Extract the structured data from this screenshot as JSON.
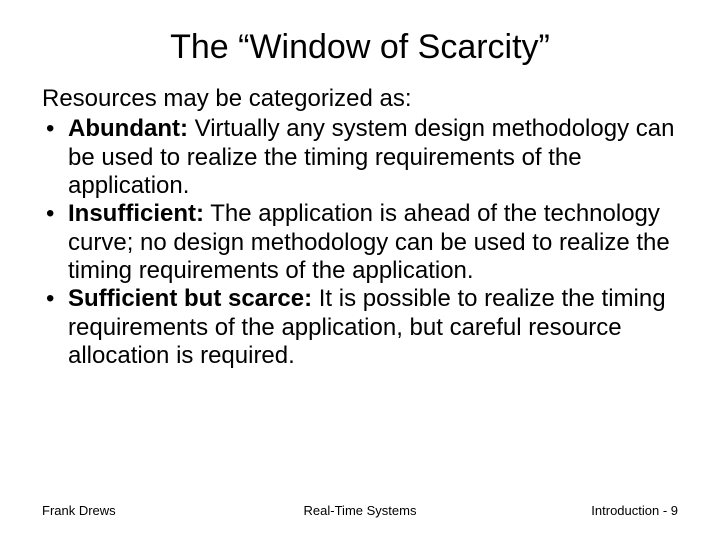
{
  "title": "The “Window of Scarcity”",
  "intro": "Resources may be categorized as:",
  "bullets": [
    {
      "term": "Abundant:",
      "text": " Virtually any system design methodology can be used to realize the timing requirements of the application."
    },
    {
      "term": "Insufficient:",
      "text": " The application is ahead of the technology curve; no design methodology can be used to realize the timing requirements of the application."
    },
    {
      "term": "Sufficient but scarce:",
      "text": " It is possible to realize the timing requirements of the application, but careful resource allocation is required."
    }
  ],
  "footer": {
    "left": "Frank Drews",
    "center": "Real-Time Systems",
    "right": "Introduction - 9"
  }
}
